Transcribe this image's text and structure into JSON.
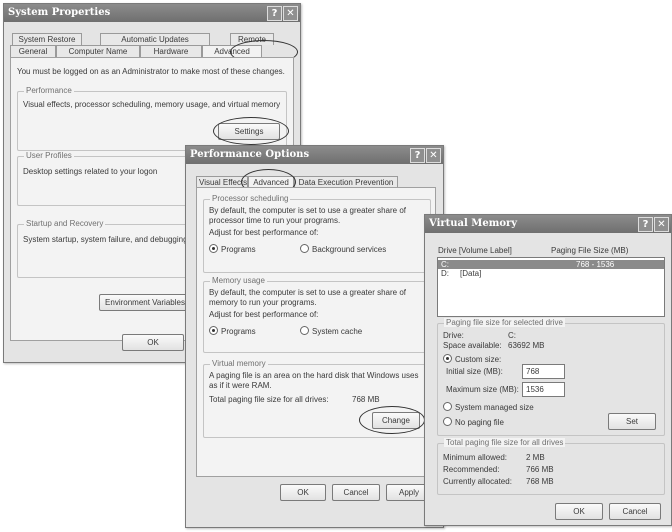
{
  "system_properties": {
    "title": "System Properties",
    "help": "?",
    "close": "✕",
    "tabs_back": [
      "System Restore",
      "Automatic Updates",
      "Remote"
    ],
    "tabs_front": [
      "General",
      "Computer Name",
      "Hardware",
      "Advanced"
    ],
    "admin_note": "You must be logged on as an Administrator to make most of these changes.",
    "performance": {
      "label": "Performance",
      "text": "Visual effects, processor scheduling, memory usage, and virtual memory",
      "button": "Settings"
    },
    "user_profiles": {
      "label": "User Profiles",
      "text": "Desktop settings related to your logon"
    },
    "startup": {
      "label": "Startup and Recovery",
      "text": "System startup, system failure, and debugging"
    },
    "env_button": "Environment Variables",
    "ok": "OK"
  },
  "performance_options": {
    "title": "Performance Options",
    "help": "?",
    "close": "✕",
    "tabs": [
      "Visual Effects",
      "Advanced",
      "Data Execution Prevention"
    ],
    "processor": {
      "label": "Processor scheduling",
      "text": "By default, the computer is set to use a greater share of processor time to run your programs.",
      "adjust": "Adjust for best performance of:",
      "opt1": "Programs",
      "opt2": "Background services"
    },
    "memory": {
      "label": "Memory usage",
      "text": "By default, the computer is set to use a greater share of memory to run your programs.",
      "adjust": "Adjust for best performance of:",
      "opt1": "Programs",
      "opt2": "System cache"
    },
    "virtual": {
      "label": "Virtual memory",
      "text": "A paging file is an area on the hard disk that Windows uses as if it were RAM.",
      "total_label": "Total paging file size for all drives:",
      "total_value": "768 MB",
      "change": "Change"
    },
    "ok": "OK",
    "cancel": "Cancel",
    "apply": "Apply"
  },
  "virtual_memory": {
    "title": "Virtual Memory",
    "help": "?",
    "close": "✕",
    "col_drive": "Drive  [Volume Label]",
    "col_size": "Paging File Size (MB)",
    "drives": [
      {
        "drive": "C:",
        "label": "",
        "size": "768 - 1536"
      },
      {
        "drive": "D:",
        "label": "[Data]",
        "size": ""
      }
    ],
    "selected_group": "Paging file size for selected drive",
    "drive_label": "Drive:",
    "drive_value": "C:",
    "space_label": "Space available:",
    "space_value": "63692 MB",
    "custom": "Custom size:",
    "initial_label": "Initial size (MB):",
    "initial_value": "768",
    "max_label": "Maximum size (MB):",
    "max_value": "1536",
    "system_managed": "System managed size",
    "no_paging": "No paging file",
    "set": "Set",
    "total_group": "Total paging file size for all drives",
    "min_label": "Minimum allowed:",
    "min_value": "2 MB",
    "rec_label": "Recommended:",
    "rec_value": "766 MB",
    "cur_label": "Currently allocated:",
    "cur_value": "768 MB",
    "ok": "OK",
    "cancel": "Cancel"
  }
}
